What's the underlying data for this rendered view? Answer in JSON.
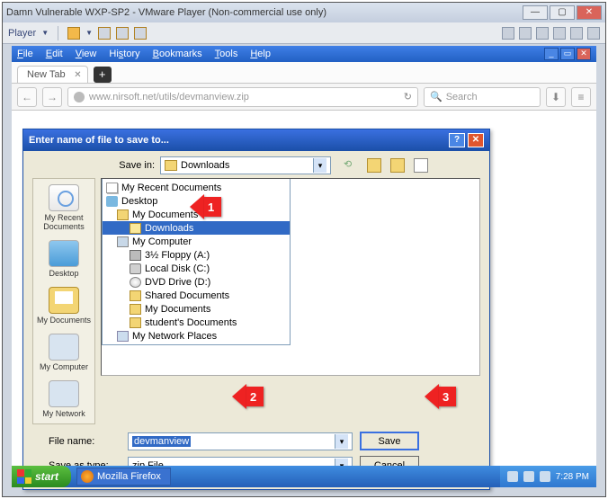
{
  "vm": {
    "title": "Damn Vulnerable WXP-SP2 - VMware Player (Non-commercial use only)",
    "player": "Player"
  },
  "ff_menu": {
    "file": "File",
    "edit": "Edit",
    "view": "View",
    "history": "History",
    "bookmarks": "Bookmarks",
    "tools": "Tools",
    "help": "Help"
  },
  "ff_tab": "New Tab",
  "url": "www.nirsoft.net/utils/devmanview.zip",
  "search_placeholder": "Search",
  "dialog": {
    "title": "Enter name of file to save to...",
    "save_in_label": "Save in:",
    "save_in_value": "Downloads",
    "filename_label": "File name:",
    "filename_value": "devmanview",
    "savetype_label": "Save as type:",
    "savetype_value": "zip File",
    "save_btn": "Save",
    "cancel_btn": "Cancel"
  },
  "tree": {
    "recent": "My Recent Documents",
    "desktop": "Desktop",
    "mydocs": "My Documents",
    "downloads": "Downloads",
    "mycomp": "My Computer",
    "floppy": "3½ Floppy (A:)",
    "localc": "Local Disk (C:)",
    "dvd": "DVD Drive (D:)",
    "shared": "Shared Documents",
    "mydocs2": "My Documents",
    "studocs": "student's Documents",
    "netplaces": "My Network Places"
  },
  "places": {
    "recent": "My Recent Documents",
    "desktop": "Desktop",
    "mydocs": "My Documents",
    "mycomp": "My Computer",
    "mynet": "My Network"
  },
  "callouts": {
    "one": "1",
    "two": "2",
    "three": "3"
  },
  "taskbar": {
    "start": "start",
    "firefox": "Mozilla Firefox",
    "time": "7:28 PM"
  }
}
